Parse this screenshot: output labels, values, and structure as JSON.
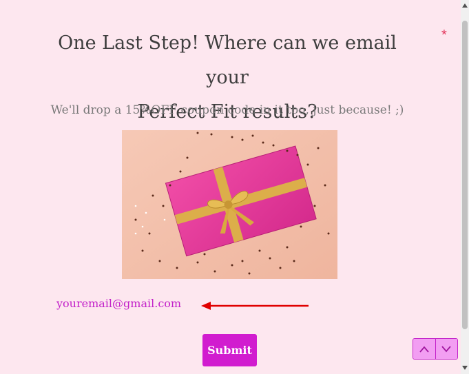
{
  "form": {
    "title_line1": "One Last Step! Where can we email your",
    "title_line2": "Perfect Fit results?",
    "required_marker": "*",
    "subtitle": "We'll drop a 15%OFF coupon code in it too, just because! ;)",
    "email_value": "youremail@gmail.com",
    "submit_label": "Submit"
  },
  "icons": {
    "previous": "chevron-up-icon",
    "next": "chevron-down-icon",
    "scroll_up": "triangle-up-icon",
    "scroll_down": "triangle-down-icon"
  },
  "colors": {
    "background": "#fde7ef",
    "accent": "#d11ccf",
    "email_text": "#c321c9",
    "required": "#e2355a",
    "arrow": "#e00000"
  }
}
